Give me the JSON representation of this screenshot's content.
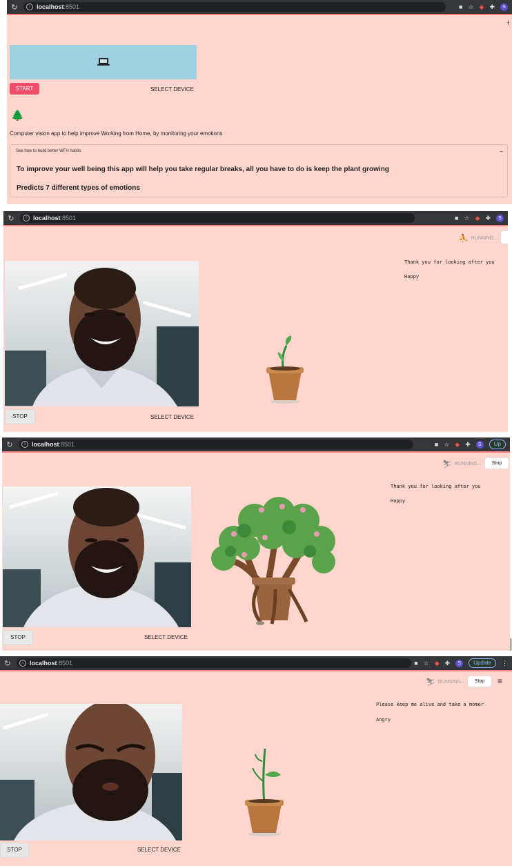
{
  "browser": {
    "host": "localhost",
    "port": ":8501",
    "update_label": "Update",
    "profile_initial": "S"
  },
  "panel1": {
    "start_label": "START",
    "select_device_label": "SELECT DEVICE",
    "tree_emoji": "🌲",
    "description": "Computer vision app to help improve Working from Home, by monitoring your emotions",
    "expander_title": "See how to build better WFH habits",
    "expander_toggle": "–",
    "expander_line1": "To improve your well being this app will help you take regular breaks, all you have to do is keep the plant growing",
    "expander_line2": "Predicts 7 different types of emotions"
  },
  "panel2": {
    "running_label": "RUNNING...",
    "stop_label": "STOP",
    "select_device_label": "SELECT DEVICE",
    "message": "Thank you for looking after you",
    "emotion": "Happy"
  },
  "panel3": {
    "running_label": "RUNNING...",
    "stop_button_label": "Stop",
    "stop_label": "STOP",
    "select_device_label": "SELECT DEVICE",
    "message": "Thank you for looking after you",
    "emotion": "Happy"
  },
  "panel4": {
    "running_label": "RUNNING...",
    "stop_button_label": "Stop",
    "stop_label": "STOP",
    "select_device_label": "SELECT DEVICE",
    "message": "Please keep me alive and take a momer",
    "emotion": "Angry"
  },
  "colors": {
    "app_background": "#ffd6ce",
    "primary_button": "#f24c6b",
    "video_placeholder": "#9fd0e0"
  }
}
